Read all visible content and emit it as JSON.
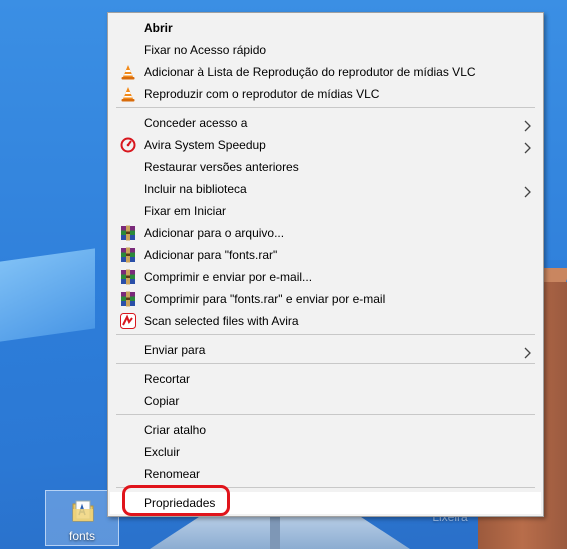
{
  "desktop": {
    "icon_label": "fonts",
    "faint_label": "Lixeira"
  },
  "menu": {
    "items": [
      {
        "label": "Abrir",
        "bold": true,
        "icon": null
      },
      {
        "label": "Fixar no Acesso rápido",
        "icon": null
      },
      {
        "label": "Adicionar à Lista de Reprodução do reprodutor de mídias VLC",
        "icon": "vlc-cone-icon"
      },
      {
        "label": "Reproduzir com o reprodutor de mídias VLC",
        "icon": "vlc-cone-icon"
      },
      {
        "label": "Conceder acesso a",
        "icon": null,
        "submenu": true
      },
      {
        "label": "Avira System Speedup",
        "icon": "avira-speedup-icon",
        "submenu": true
      },
      {
        "label": "Restaurar versões anteriores",
        "icon": null
      },
      {
        "label": "Incluir na biblioteca",
        "icon": null,
        "submenu": true
      },
      {
        "label": "Fixar em Iniciar",
        "icon": null
      },
      {
        "label": "Adicionar para o arquivo...",
        "icon": "winrar-icon"
      },
      {
        "label": "Adicionar para \"fonts.rar\"",
        "icon": "winrar-icon"
      },
      {
        "label": "Comprimir e enviar por e-mail...",
        "icon": "winrar-icon"
      },
      {
        "label": "Comprimir para \"fonts.rar\" e enviar por e-mail",
        "icon": "winrar-icon"
      },
      {
        "label": "Scan selected files with Avira",
        "icon": "avira-umbrella-icon"
      },
      {
        "label": "Enviar para",
        "icon": null,
        "submenu": true
      },
      {
        "label": "Recortar",
        "icon": null
      },
      {
        "label": "Copiar",
        "icon": null
      },
      {
        "label": "Criar atalho",
        "icon": null
      },
      {
        "label": "Excluir",
        "icon": null
      },
      {
        "label": "Renomear",
        "icon": null
      },
      {
        "label": "Propriedades",
        "icon": null,
        "highlighted": true
      }
    ]
  },
  "colors": {
    "menu_bg": "#f2f2f2",
    "highlight_ring": "#e0141b",
    "desktop_bg": "#2f7fda"
  }
}
